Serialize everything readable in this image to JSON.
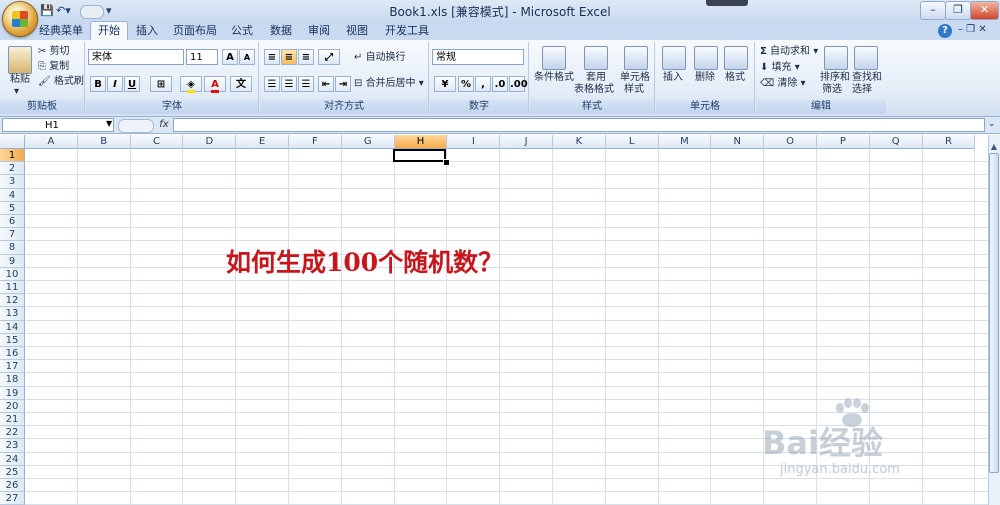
{
  "window": {
    "title": "Book1.xls  [兼容模式] - Microsoft Excel",
    "quick_access": [
      "save-icon",
      "undo-icon",
      "redo-icon"
    ]
  },
  "tabs": [
    "经典菜单",
    "开始",
    "插入",
    "页面布局",
    "公式",
    "数据",
    "审阅",
    "视图",
    "开发工具"
  ],
  "active_tab": "开始",
  "ribbon": {
    "clipboard": {
      "label": "剪贴板",
      "paste": "粘贴",
      "cut": "剪切",
      "copy": "复制",
      "format_painter": "格式刷"
    },
    "font": {
      "label": "字体",
      "font_name": "宋体",
      "font_size": "11",
      "bold": "B",
      "italic": "I",
      "underline": "U",
      "grow": "A",
      "shrink": "A",
      "font_color": "A",
      "phonetic": "文"
    },
    "alignment": {
      "label": "对齐方式",
      "wrap_text": "自动换行",
      "merge_center": "合并后居中"
    },
    "number": {
      "label": "数字",
      "format": "常规",
      "percent": "%",
      "comma": ","
    },
    "styles": {
      "label": "样式",
      "conditional": "条件格式",
      "table_1": "套用",
      "table_2": "表格格式",
      "cell_styles_1": "单元格",
      "cell_styles_2": "样式"
    },
    "cells": {
      "label": "单元格",
      "insert": "插入",
      "delete": "删除",
      "format": "格式"
    },
    "editing": {
      "label": "编辑",
      "autosum": "自动求和",
      "sigma": "Σ",
      "fill": "填充",
      "clear": "清除",
      "sort_1": "排序和",
      "sort_2": "筛选",
      "find_1": "查找和",
      "find_2": "选择"
    }
  },
  "formula_bar": {
    "name_box": "H1",
    "fx": "fx",
    "content": ""
  },
  "columns": [
    "A",
    "B",
    "C",
    "D",
    "E",
    "F",
    "G",
    "H",
    "I",
    "J",
    "K",
    "L",
    "M",
    "N",
    "O",
    "P",
    "Q",
    "R"
  ],
  "rows": [
    "1",
    "2",
    "3",
    "4",
    "5",
    "6",
    "7",
    "8",
    "9",
    "10",
    "11",
    "12",
    "13",
    "14",
    "15",
    "16",
    "17",
    "18",
    "19",
    "20",
    "21",
    "22",
    "23",
    "24",
    "25",
    "26",
    "27"
  ],
  "selected": {
    "column": "H",
    "row": "1"
  },
  "sheet_text": "如何生成100个随机数？",
  "watermark": {
    "brand": "Bai经验",
    "url": "jingyan.baidu.com"
  },
  "colors": {
    "accent": "#f7a94c",
    "text_red": "#c8161d",
    "ribbon": "#dfe9f5"
  }
}
